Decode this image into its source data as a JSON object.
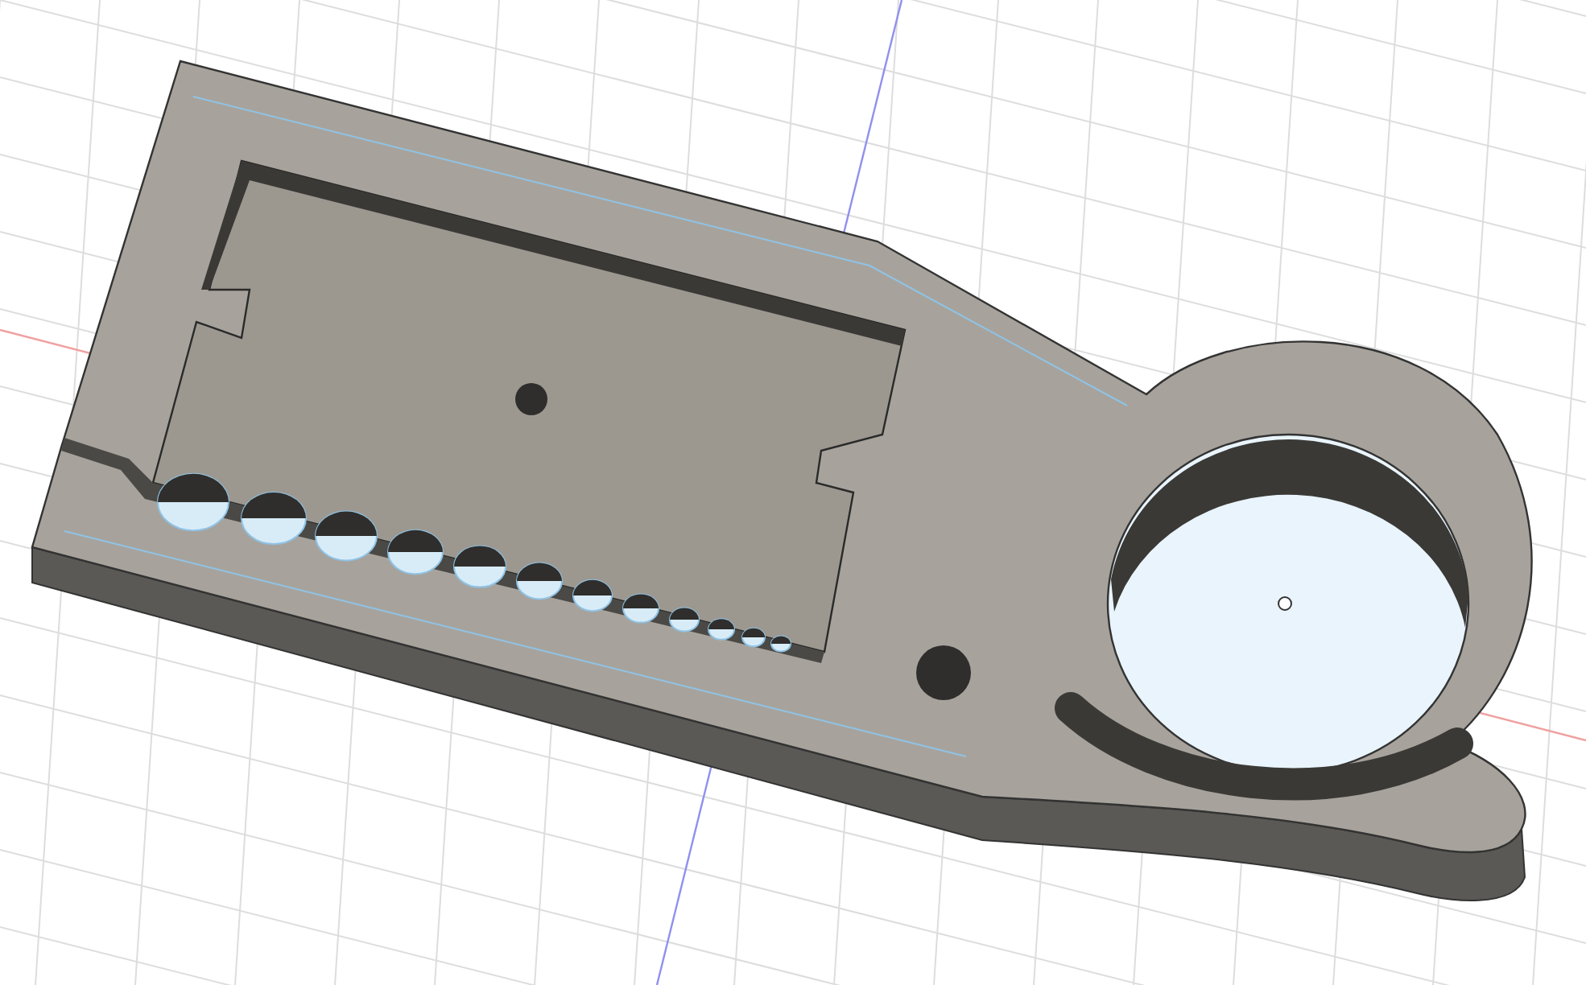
{
  "viewport": {
    "kind": "model-view"
  }
}
